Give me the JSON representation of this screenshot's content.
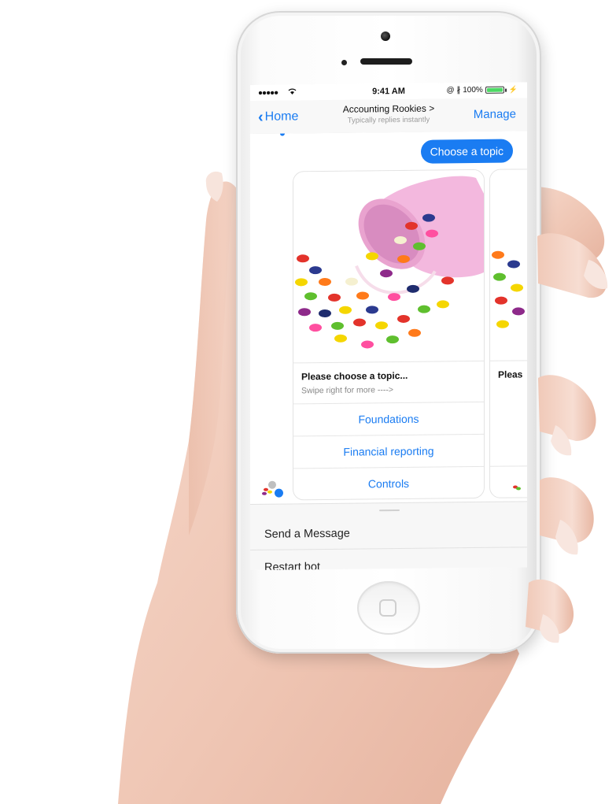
{
  "status_bar": {
    "signal": "●●●●●",
    "wifi_icon": "wifi-icon",
    "time": "9:41 AM",
    "right": "@ ∦ 100%",
    "battery_color": "#4cd964"
  },
  "nav": {
    "back_label": "Home",
    "title": "Accounting Rookies >",
    "subtitle": "Typically replies instantly",
    "manage_label": "Manage",
    "accent": "#1a7cf2"
  },
  "chat": {
    "user_message": "Choose a topic",
    "carousel": {
      "cards": [
        {
          "title": "Please choose a topic...",
          "subtitle": "Swipe right for more ---->",
          "buttons": [
            "Foundations",
            "Financial reporting",
            "Controls"
          ]
        },
        {
          "title": "Pleas"
        }
      ]
    }
  },
  "composer": {
    "items": [
      "Send a Message",
      "Restart bot"
    ]
  }
}
